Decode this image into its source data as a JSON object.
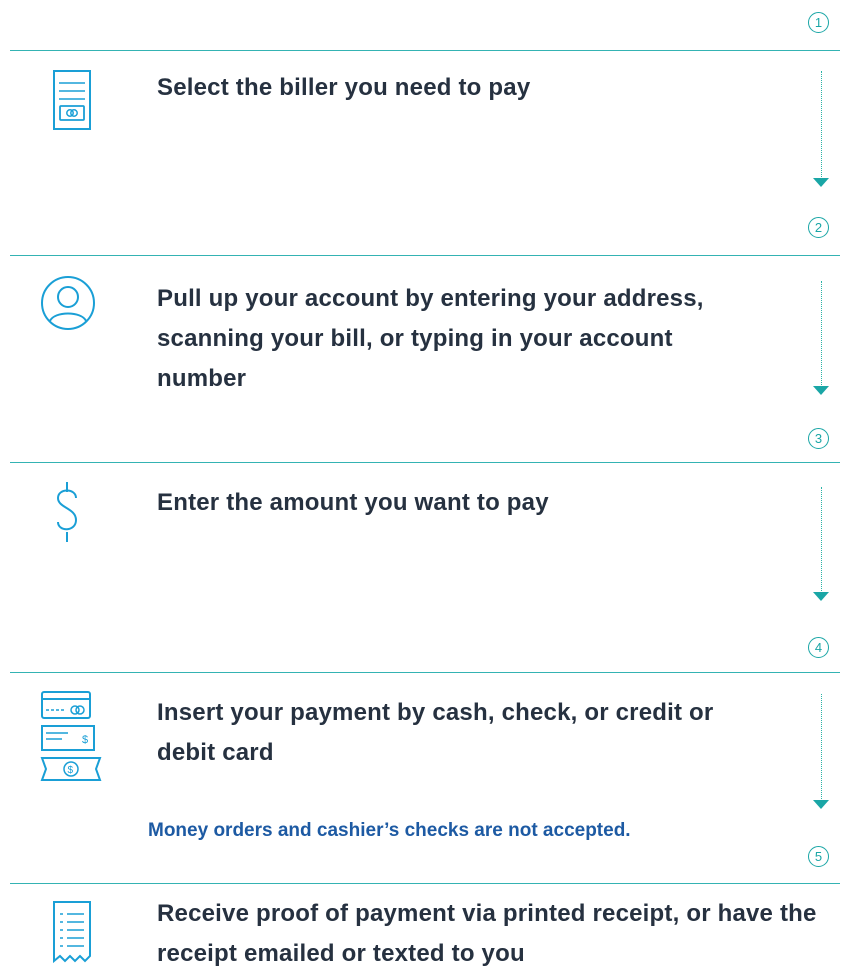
{
  "steps": [
    {
      "number": "1",
      "text": "Select the biller you need to pay",
      "icon": "bill-icon"
    },
    {
      "number": "2",
      "text": "Pull up your account by entering your address, scanning your bill, or typing in your account number",
      "icon": "user-icon"
    },
    {
      "number": "3",
      "text": "Enter the amount you want to pay",
      "icon": "dollar-icon"
    },
    {
      "number": "4",
      "text": "Insert your payment by cash, check, or credit or debit card",
      "icon": "payment-methods-icon"
    },
    {
      "number": "5",
      "text": "Receive proof of payment via printed receipt, or have the receipt emailed or texted to you",
      "icon": "receipt-icon"
    }
  ],
  "note": "Money orders and cashier’s checks are not accepted.",
  "colors": {
    "teal": "#1aa6a6",
    "text": "#263140",
    "note": "#1d5aa3",
    "icon": "#1a9fd6"
  }
}
